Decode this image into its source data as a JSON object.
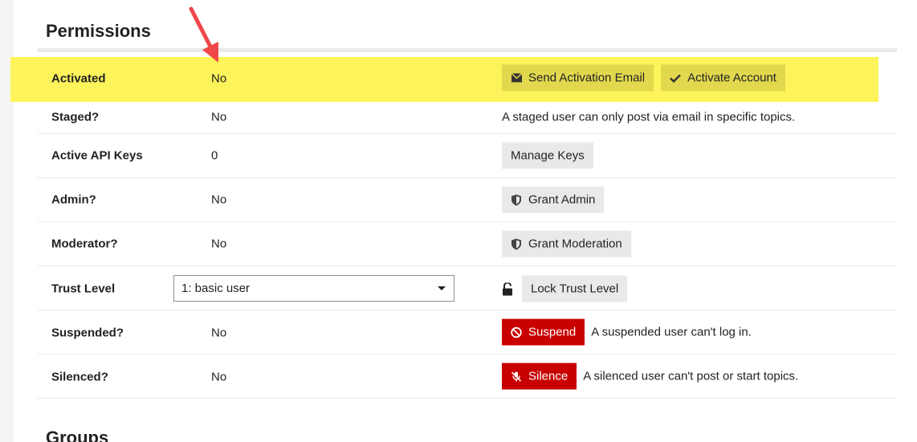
{
  "permissions": {
    "title": "Permissions",
    "rows": {
      "activated": {
        "label": "Activated",
        "value": "No",
        "send_activation_label": "Send Activation Email",
        "activate_account_label": "Activate Account"
      },
      "staged": {
        "label": "Staged?",
        "value": "No",
        "help": "A staged user can only post via email in specific topics."
      },
      "api_keys": {
        "label": "Active API Keys",
        "value": "0",
        "manage_label": "Manage Keys"
      },
      "admin": {
        "label": "Admin?",
        "value": "No",
        "grant_label": "Grant Admin"
      },
      "moderator": {
        "label": "Moderator?",
        "value": "No",
        "grant_label": "Grant Moderation"
      },
      "trust_level": {
        "label": "Trust Level",
        "selected": "1: basic user",
        "lock_label": "Lock Trust Level"
      },
      "suspended": {
        "label": "Suspended?",
        "value": "No",
        "button_label": "Suspend",
        "help": "A suspended user can't log in."
      },
      "silenced": {
        "label": "Silenced?",
        "value": "No",
        "button_label": "Silence",
        "help": "A silenced user can't post or start topics."
      }
    }
  },
  "groups": {
    "title": "Groups"
  },
  "colors": {
    "highlight": "#fdf35a",
    "annotation_arrow": "#f0474a",
    "danger": "#c80001"
  },
  "icons": [
    "envelope-icon",
    "check-icon",
    "shield-icon",
    "unlock-icon",
    "ban-icon",
    "microphone-slash-icon",
    "caret-down-icon",
    "annotation-arrow"
  ]
}
